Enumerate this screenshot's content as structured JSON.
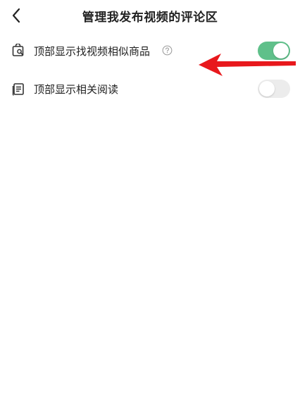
{
  "header": {
    "title": "管理我发布视频的评论区",
    "back_icon": "chevron-left-icon"
  },
  "settings": [
    {
      "label": "顶部显示找视频相似商品",
      "icon": "shopping-bag-icon",
      "has_help": true,
      "help_icon": "question-circle-icon",
      "enabled": true
    },
    {
      "label": "顶部显示相关阅读",
      "icon": "document-icon",
      "has_help": false,
      "enabled": false
    }
  ],
  "colors": {
    "toggle_on": "#5fc08a",
    "toggle_off": "#ececec",
    "annotation_arrow": "#e8181c"
  },
  "annotation": {
    "type": "red-arrow",
    "points_to": "settings.0.label"
  }
}
